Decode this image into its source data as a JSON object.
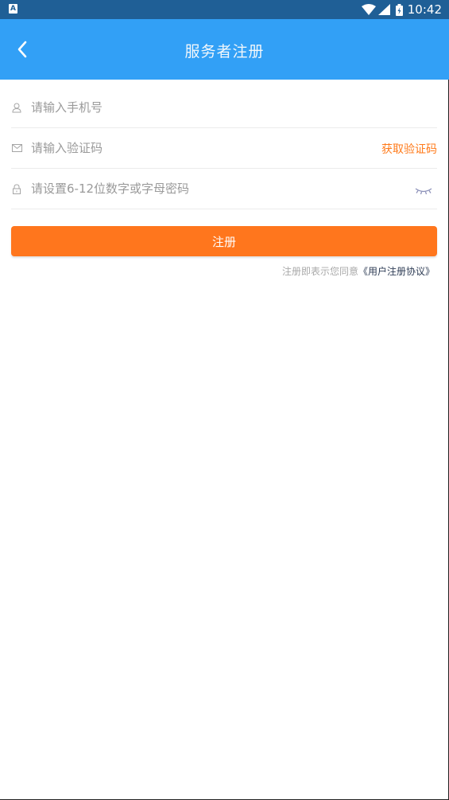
{
  "status_bar": {
    "time": "10:42",
    "left_icon": "A"
  },
  "header": {
    "title": "服务者注册",
    "back_icon": "chevron-left-icon"
  },
  "form": {
    "phone_placeholder": "请输入手机号",
    "code_placeholder": "请输入验证码",
    "get_code_label": "获取验证码",
    "password_placeholder": "请设置6-12位数字或字母密码"
  },
  "submit_label": "注册",
  "agreement": {
    "prefix": "注册即表示您同意",
    "link": "《用户注册协议》"
  },
  "colors": {
    "status_bar": "#1f5f96",
    "app_bar": "#32a0f6",
    "accent_orange": "#ff761d",
    "link_dark": "#2f3d56"
  }
}
